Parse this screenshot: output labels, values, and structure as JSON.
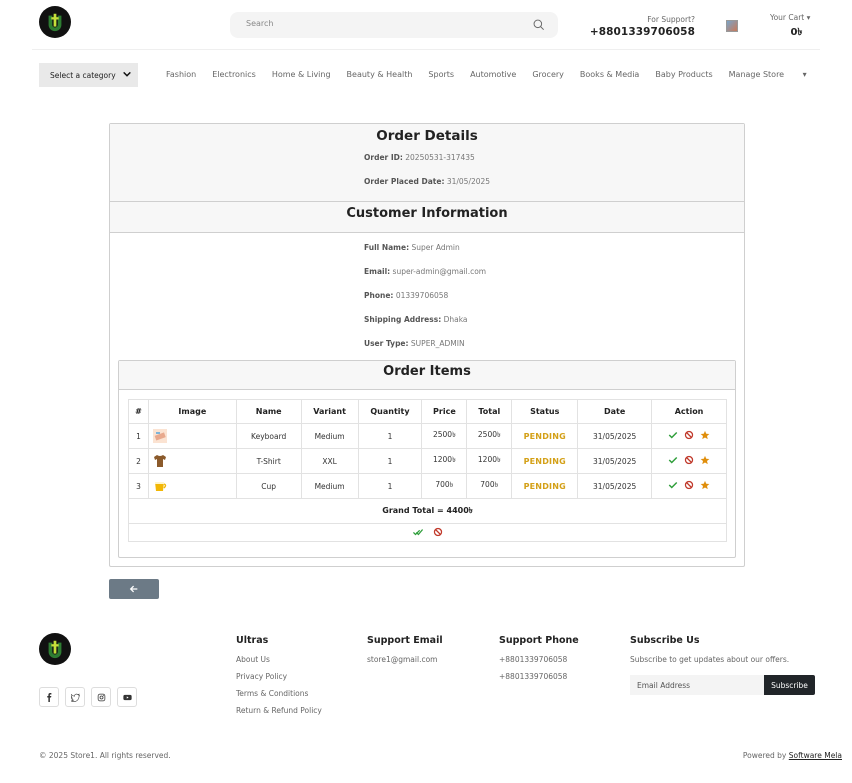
{
  "header": {
    "search_placeholder": "Search",
    "support_label": "For Support?",
    "support_phone": "+8801339706058",
    "cart_label": "Your Cart",
    "cart_amount": "0৳"
  },
  "nav": {
    "category_select": "Select a category",
    "items": [
      "Fashion",
      "Electronics",
      "Home & Living",
      "Beauty & Health",
      "Sports",
      "Automotive",
      "Grocery",
      "Books & Media",
      "Baby Products",
      "Manage Store"
    ]
  },
  "order": {
    "title": "Order Details",
    "id_label": "Order ID:",
    "id_value": "20250531-317435",
    "date_label": "Order Placed Date:",
    "date_value": "31/05/2025"
  },
  "customer": {
    "title": "Customer Information",
    "name_label": "Full Name:",
    "name_value": "Super Admin",
    "email_label": "Email:",
    "email_value": "super-admin@gmail.com",
    "phone_label": "Phone:",
    "phone_value": "01339706058",
    "address_label": "Shipping Address:",
    "address_value": "Dhaka",
    "usertype_label": "User Type:",
    "usertype_value": "SUPER_ADMIN"
  },
  "items": {
    "title": "Order Items",
    "columns": [
      "#",
      "Image",
      "Name",
      "Variant",
      "Quantity",
      "Price",
      "Total",
      "Status",
      "Date",
      "Action"
    ],
    "rows": [
      {
        "num": "1",
        "name": "Keyboard",
        "variant": "Medium",
        "qty": "1",
        "price": "2500৳",
        "total": "2500৳",
        "status": "PENDING",
        "date": "31/05/2025"
      },
      {
        "num": "2",
        "name": "T-Shirt",
        "variant": "XXL",
        "qty": "1",
        "price": "1200৳",
        "total": "1200৳",
        "status": "PENDING",
        "date": "31/05/2025"
      },
      {
        "num": "3",
        "name": "Cup",
        "variant": "Medium",
        "qty": "1",
        "price": "700৳",
        "total": "700৳",
        "status": "PENDING",
        "date": "31/05/2025"
      }
    ],
    "grand_total": "Grand Total = 4400৳"
  },
  "footer": {
    "col1_title": "Ultras",
    "col1_links": [
      "About Us",
      "Privacy Policy",
      "Terms & Conditions",
      "Return & Refund Policy"
    ],
    "col2_title": "Support Email",
    "col2_email": "store1@gmail.com",
    "col3_title": "Support Phone",
    "col3_phones": [
      "+8801339706058",
      "+8801339706058"
    ],
    "col4_title": "Subscribe Us",
    "col4_text": "Subscribe to get updates about our offers.",
    "email_placeholder": "Email Address",
    "subscribe_label": "Subscribe",
    "copyright": "© 2025 Store1. All rights reserved.",
    "powered_by": "Powered by",
    "powered_link": "Software Mela"
  },
  "colors": {
    "status_pending": "#d4a017",
    "approve": "#2e9e3a",
    "cancel": "#c0392b",
    "star": "#e08e0b",
    "back_button": "#6c7a86"
  }
}
